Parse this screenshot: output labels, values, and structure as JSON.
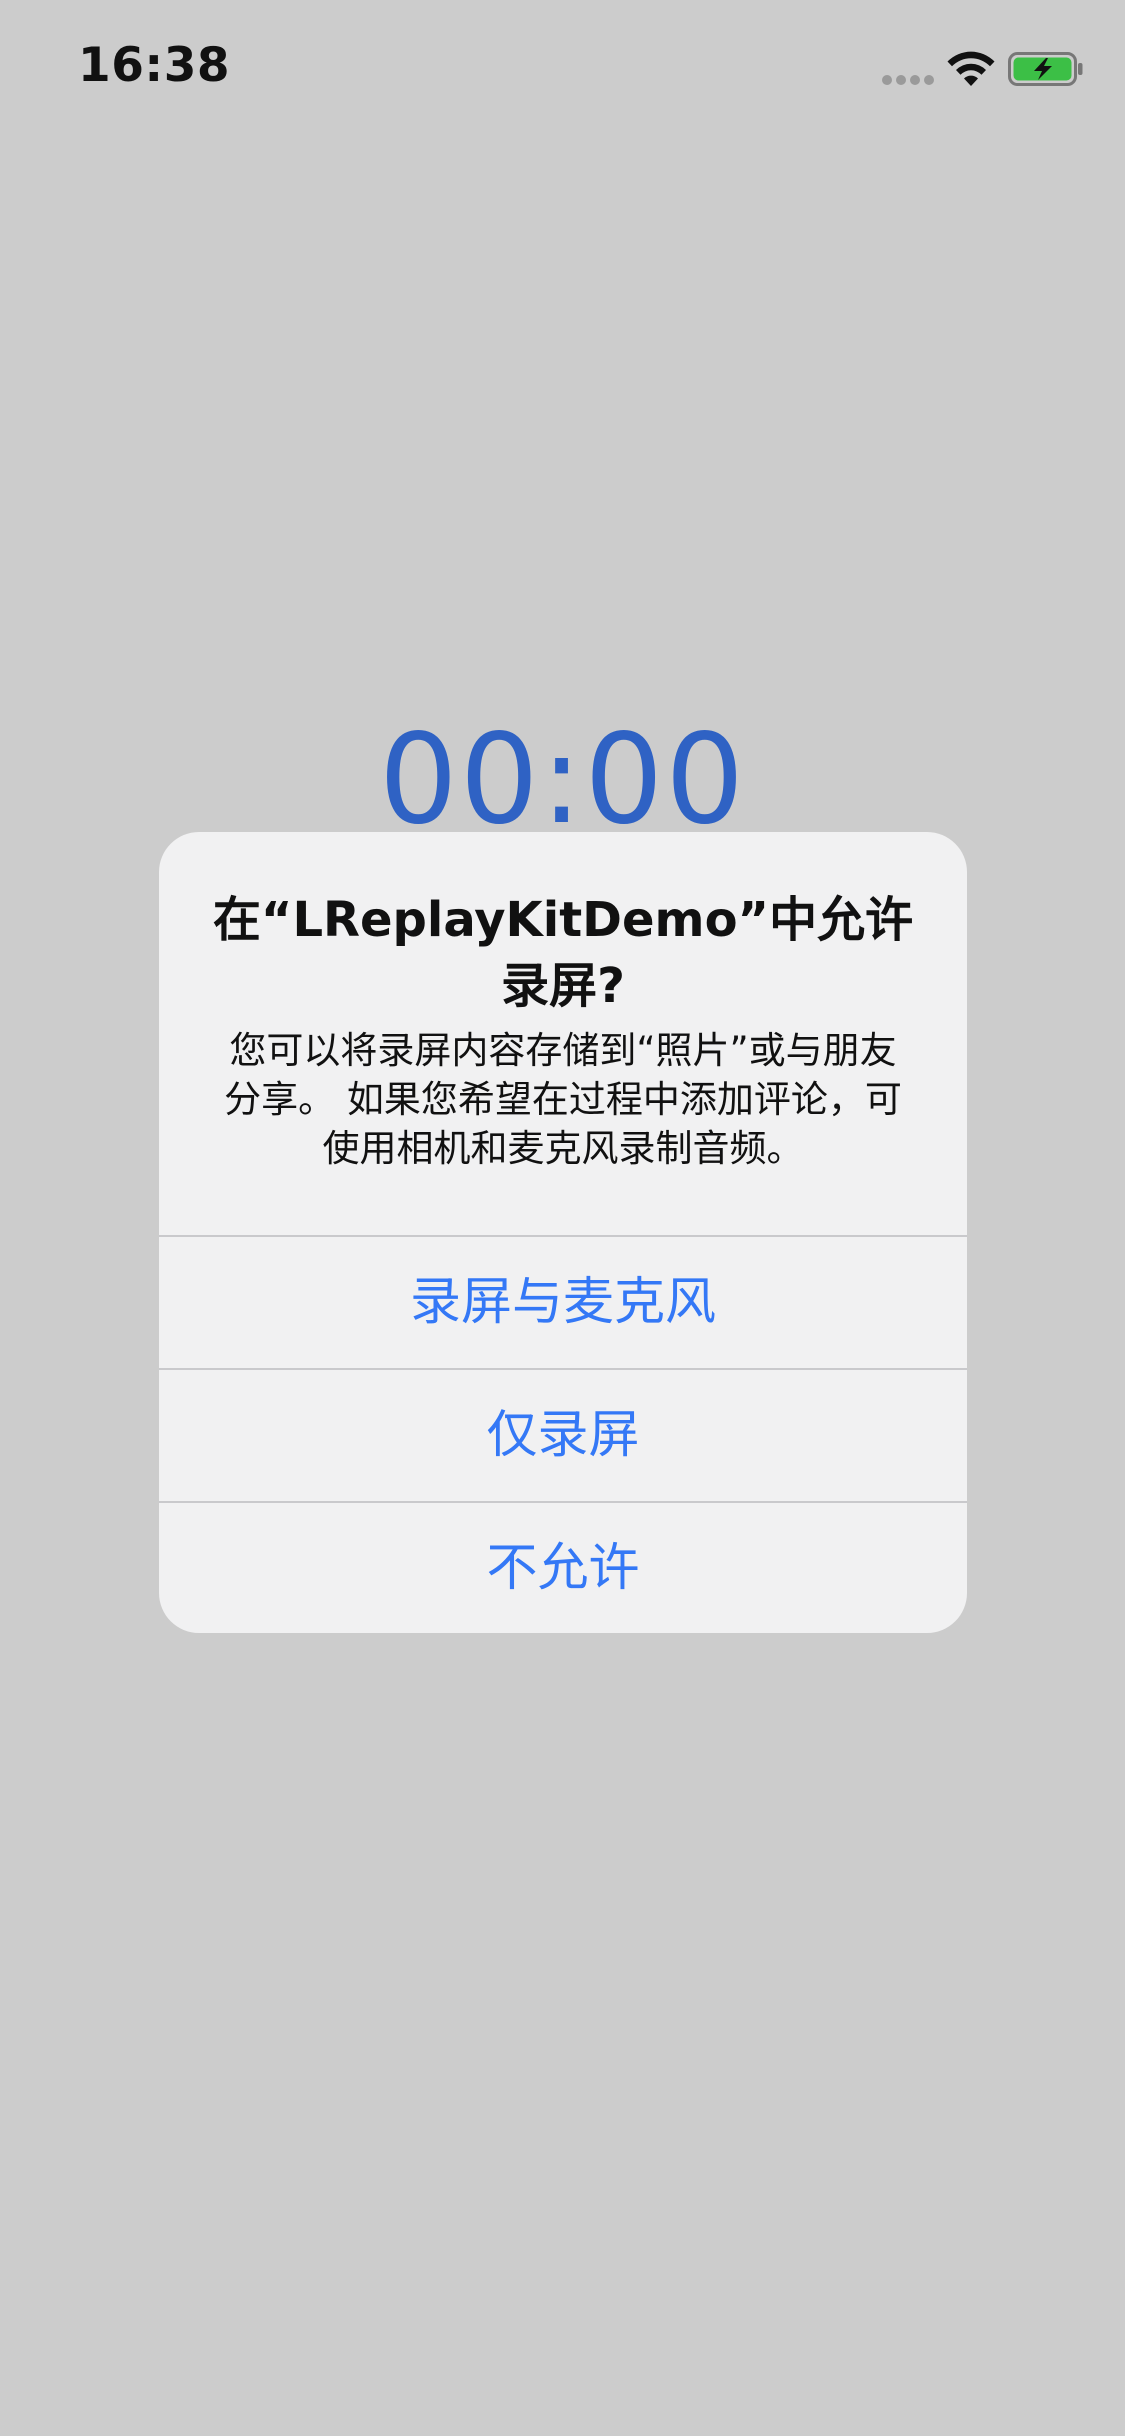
{
  "status_bar": {
    "time": "16:38",
    "signal_icon": "signal-dots-icon",
    "wifi_icon": "wifi-icon",
    "battery_icon": "battery-charging-icon",
    "battery_color": "#3cbf46"
  },
  "timer": {
    "value": "00:00",
    "color": "#2f62c4"
  },
  "alert": {
    "title": "在“LReplayKitDemo”中允许录屏?",
    "message": "您可以将录屏内容存储到“照片”或与朋友分享。 如果您希望在过程中添加评论，可使用相机和麦克风录制音频。",
    "buttons": [
      {
        "label": "录屏与麦克风"
      },
      {
        "label": "仅录屏"
      },
      {
        "label": "不允许"
      }
    ],
    "button_color": "#3478f6"
  }
}
